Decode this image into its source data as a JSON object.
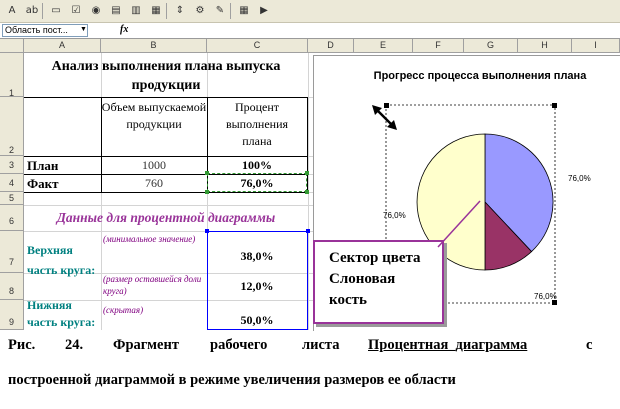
{
  "toolbar": {
    "icons": [
      "text-format-icon",
      "label-icon",
      "group-box-icon",
      "checkbox-icon",
      "option-button-icon",
      "list-box-icon",
      "combo-box-icon",
      "scroll-bar-icon",
      "spinner-icon",
      "properties-icon",
      "edit-code-icon",
      "toggle-grid-icon",
      "run-dialog-icon"
    ]
  },
  "formula_bar": {
    "name_box": "Область пост...",
    "fx_label": "fx"
  },
  "columns": [
    "A",
    "B",
    "C",
    "D",
    "E",
    "F",
    "G",
    "H",
    "I"
  ],
  "rows": [
    "1",
    "2",
    "3",
    "4",
    "5",
    "6",
    "7",
    "8",
    "9"
  ],
  "sheet": {
    "title": "Анализ выполнения плана выпуска продукции",
    "header_b": "Объем выпускаемой продукции",
    "header_c": "Процент выполнения плана",
    "plan_label": "План",
    "plan_volume": "1000",
    "plan_percent": "100%",
    "fact_label": "Факт",
    "fact_volume": "760",
    "fact_percent": "76,0%",
    "section_title": "Данные для процентной диаграммы",
    "upper_label": "Верхняя часть круга:",
    "upper_note_1": "(минимальное значение)",
    "upper_value_1": "38,0%",
    "upper_note_2": "(размер оставшейся доли круга)",
    "upper_value_2": "12,0%",
    "lower_label": "Нижняя часть круга:",
    "lower_note": "(скрытая)",
    "lower_value": "50,0%"
  },
  "chart_data": {
    "type": "pie",
    "title": "Прогресс процесса выполнения плана",
    "slices": [
      {
        "value": 38.0,
        "color": "#9999ff"
      },
      {
        "value": 12.0,
        "color": "#993366"
      },
      {
        "value": 50.0,
        "color": "#ffffcc"
      }
    ],
    "data_labels": [
      "76,0%",
      "76,0%",
      "76,0%"
    ]
  },
  "callout": {
    "line1": "Сектор цвета",
    "line2": "Слоновая",
    "line3": "кость"
  },
  "caption": {
    "line1_parts": [
      "Рис.",
      "24.",
      "Фрагмент",
      "рабочего",
      "листа",
      "Процентная_диаграмма",
      "с"
    ],
    "line2": "построенной диаграммой в режиме увеличения размеров ее области"
  },
  "colors": {
    "section_title": "#993399",
    "label_teal": "#008080",
    "note_purple": "#800080",
    "selection_blue": "#0000ff",
    "selection_green": "#339933",
    "callout_border": "#993399"
  }
}
